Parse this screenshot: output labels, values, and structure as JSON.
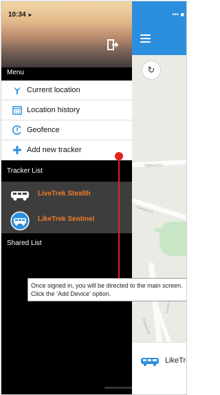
{
  "status_bar": {
    "time": "10:34",
    "location_glyph": "➤",
    "right_icons": "•••  ■"
  },
  "drawer": {
    "menu_label": "Menu",
    "menu_items": [
      {
        "label": "Current location",
        "icon": "location-pin-icon"
      },
      {
        "label": "Location history",
        "icon": "calendar-icon"
      },
      {
        "label": "Geofence",
        "icon": "geofence-icon"
      },
      {
        "label": "Add new tracker",
        "icon": "plus-icon"
      }
    ],
    "tracker_list_label": "Tracker List",
    "trackers": [
      {
        "name": "LiveTrek Stealth",
        "icon": "van-icon"
      },
      {
        "name": "LikeTrek Sentinel",
        "icon": "van-circle-icon"
      }
    ],
    "shared_list_label": "Shared List"
  },
  "map": {
    "geofence_button_glyph": "↻",
    "street_labels": [
      "Highland Dr",
      "Hamaka Ct",
      "Timber Ct",
      "Fairfield Dr"
    ],
    "bottom_card_name": "LikeTre"
  },
  "annotation": {
    "text": "Once signed in, you will be directed to the main screen. Click the ‘Add Device’ option."
  },
  "colors": {
    "accent_blue": "#2c8fde",
    "tracker_orange": "#f07c2a",
    "annotation_red": "#e2231a"
  }
}
